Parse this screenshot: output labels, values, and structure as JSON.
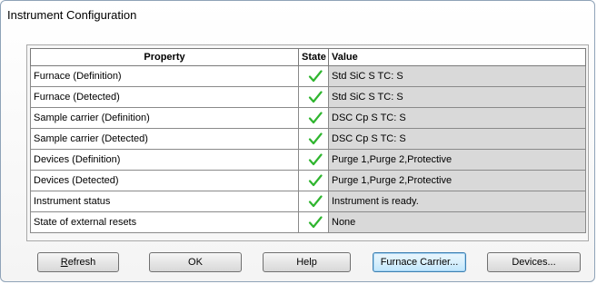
{
  "window": {
    "title": "Instrument Configuration"
  },
  "table": {
    "headers": {
      "property": "Property",
      "state": "State",
      "value": "Value"
    },
    "rows": [
      {
        "property": "Furnace (Definition)",
        "state": "ok",
        "value": "Std SiC S TC: S"
      },
      {
        "property": "Furnace (Detected)",
        "state": "ok",
        "value": "Std SiC S TC: S"
      },
      {
        "property": "Sample carrier (Definition)",
        "state": "ok",
        "value": "DSC Cp S TC: S"
      },
      {
        "property": "Sample carrier (Detected)",
        "state": "ok",
        "value": "DSC Cp S TC: S"
      },
      {
        "property": "Devices (Definition)",
        "state": "ok",
        "value": "Purge 1,Purge 2,Protective"
      },
      {
        "property": "Devices (Detected)",
        "state": "ok",
        "value": "Purge 1,Purge 2,Protective"
      },
      {
        "property": "Instrument status",
        "state": "ok",
        "value": "Instrument is ready."
      },
      {
        "property": "State of external resets",
        "state": "ok",
        "value": "None"
      }
    ],
    "check_color": "#2fb52f"
  },
  "buttons": {
    "refresh_first": "R",
    "refresh_rest": "efresh",
    "ok": "OK",
    "help": "Help",
    "furnace_carrier": "Furnace Carrier...",
    "devices": "Devices..."
  }
}
